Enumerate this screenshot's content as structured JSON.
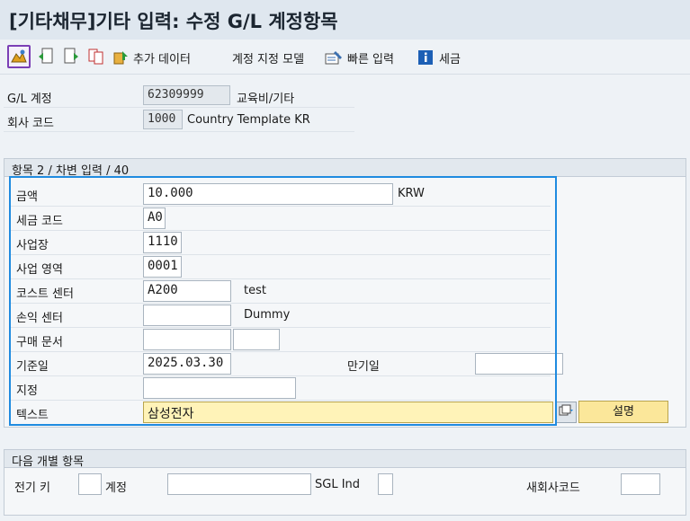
{
  "window": {
    "title": "[기타채무]기타 입력: 수정 G/L 계정항목"
  },
  "toolbar": {
    "add_data_label": "추가 데이터",
    "account_model_label": "계정 지정 모델",
    "fast_entry_label": "빠른 입력",
    "tax_label": "세금"
  },
  "header": {
    "gl_account_label": "G/L 계정",
    "gl_account_value": "62309999",
    "gl_account_desc": "교육비/기타",
    "company_code_label": "회사 코드",
    "company_code_value": "1000",
    "company_code_desc": "Country Template KR"
  },
  "item": {
    "section_title": "항목 2 / 차변 입력 / 40",
    "amount_label": "금액",
    "amount_value": "10.000",
    "currency": "KRW",
    "tax_code_label": "세금 코드",
    "tax_code_value": "A0",
    "business_place_label": "사업장",
    "business_place_value": "1110",
    "business_area_label": "사업 영역",
    "business_area_value": "0001",
    "cost_center_label": "코스트 센터",
    "cost_center_value": "A200",
    "cost_center_desc": "test",
    "profit_center_label": "손익 센터",
    "profit_center_value": "",
    "profit_center_desc": "Dummy",
    "purchase_doc_label": "구매 문서",
    "purchase_doc_value": "",
    "purchase_doc_item": "",
    "baseline_date_label": "기준일",
    "baseline_date_value": "2025.03.30",
    "due_date_label": "만기일",
    "due_date_value": "",
    "assignment_label": "지정",
    "assignment_value": "",
    "text_label": "텍스트",
    "text_value": "삼성전자",
    "desc_button": "설명"
  },
  "next_item": {
    "section_title": "다음 개별 항목",
    "posting_key_label": "전기 키",
    "posting_key_value": "",
    "account_label": "계정",
    "account_value": "",
    "sgl_label": "SGL Ind",
    "sgl_value": "",
    "new_company_label": "새회사코드",
    "new_company_value": ""
  }
}
